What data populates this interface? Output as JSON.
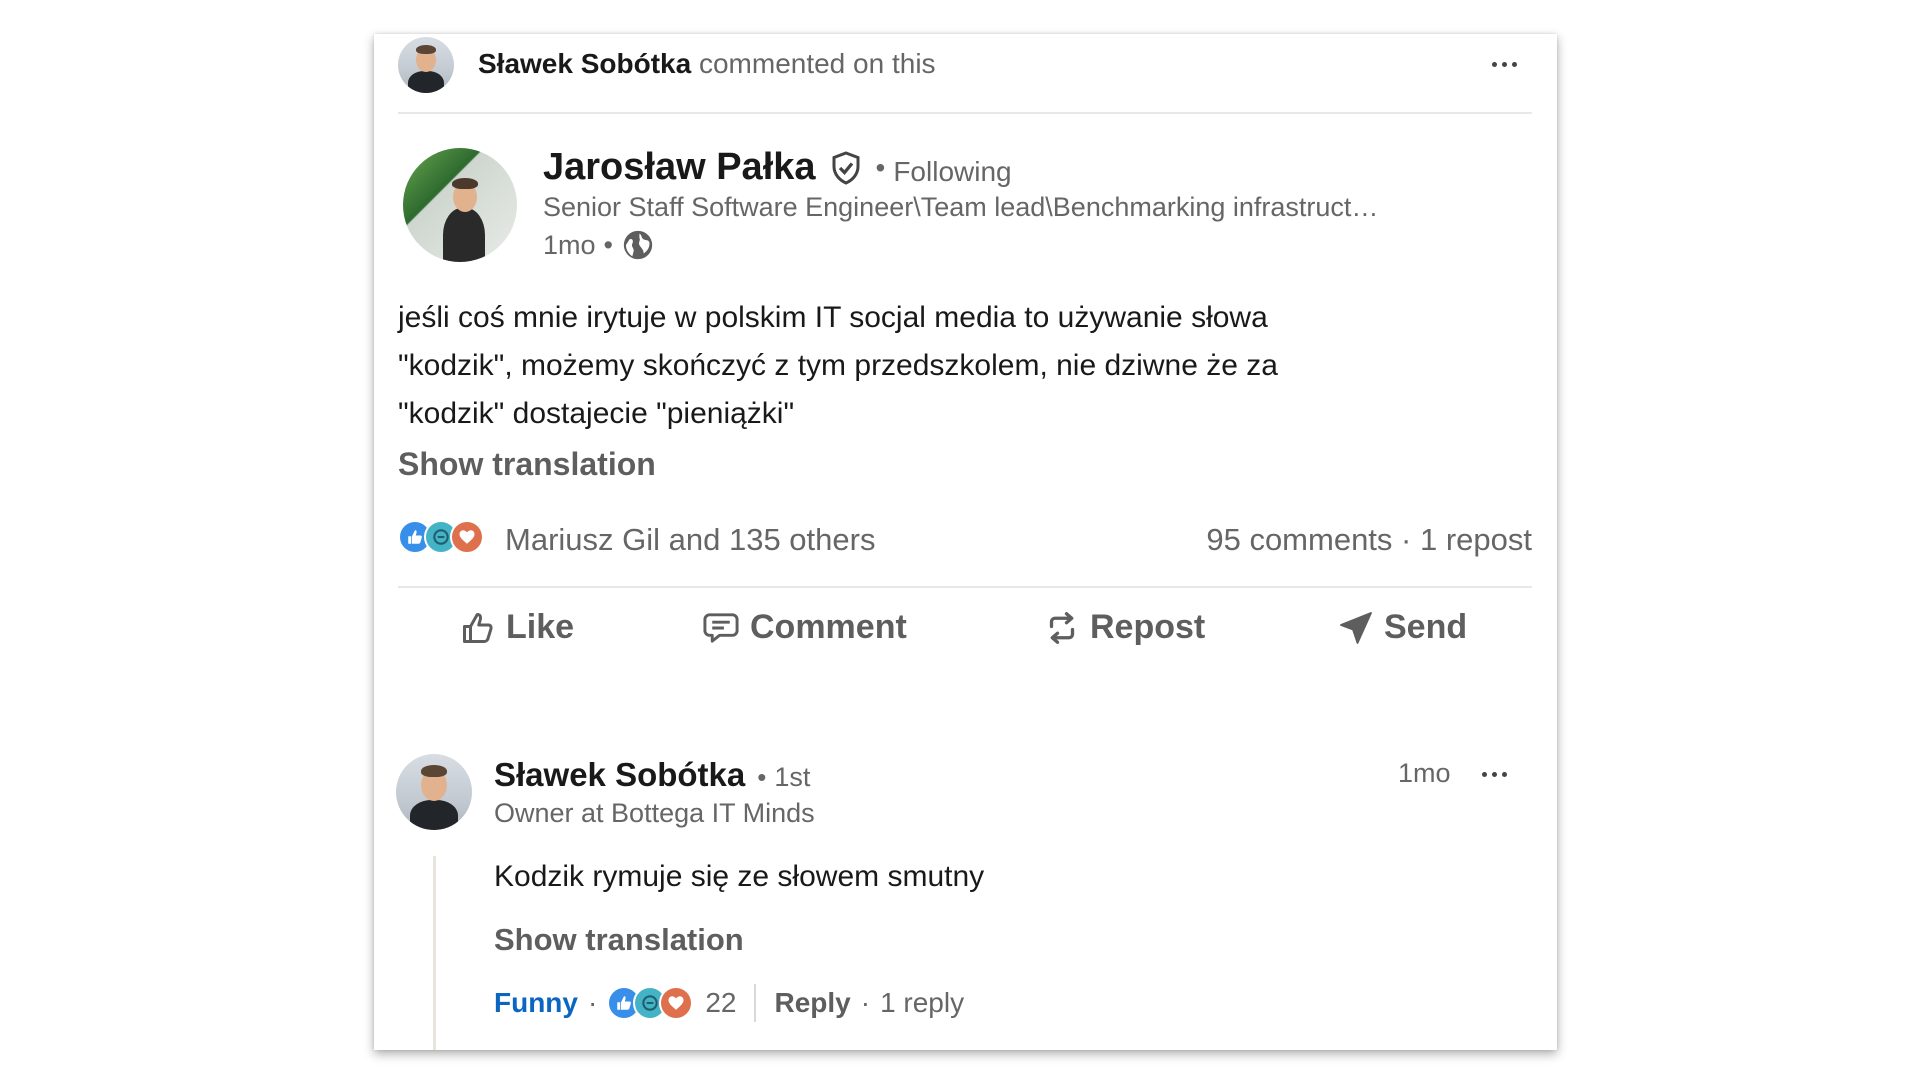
{
  "header": {
    "actor_name": "Sławek Sobótka",
    "actor_action": "commented on this"
  },
  "post": {
    "author_name": "Jarosław Pałka",
    "follow_status": "Following",
    "author_headline": "Senior Staff Software Engineer\\Team lead\\Benchmarking infrastruct…",
    "timestamp": "1mo",
    "text_lines": [
      "jeśli coś mnie irytuje w polskim IT socjal media to używanie słowa",
      "\"kodzik\", możemy skończyć z tym przedszkolem, nie dziwne że za",
      "\"kodzik\" dostajecie \"pieniążki\""
    ],
    "show_translation": "Show translation",
    "reactions_text": "Mariusz Gil and 135 others",
    "comments_count": "95 comments",
    "reposts_count": "1 repost"
  },
  "actions": {
    "like": "Like",
    "comment": "Comment",
    "repost": "Repost",
    "send": "Send"
  },
  "comment": {
    "author_name": "Sławek Sobótka",
    "degree": "1st",
    "headline": "Owner at Bottega IT Minds",
    "timestamp": "1mo",
    "text": "Kodzik rymuje się ze słowem smutny",
    "show_translation": "Show translation",
    "reaction_label": "Funny",
    "reaction_count": "22",
    "reply_label": "Reply",
    "reply_count": "1 reply"
  },
  "colors": {
    "funny_accent": "#0a66c2",
    "like_blue": "#378fe9",
    "celebrate_teal": "#44b3c6",
    "love_red": "#df704d"
  },
  "icons": [
    "more-icon",
    "verified-icon",
    "globe-icon",
    "like-icon",
    "comment-icon",
    "repost-icon",
    "send-icon"
  ]
}
